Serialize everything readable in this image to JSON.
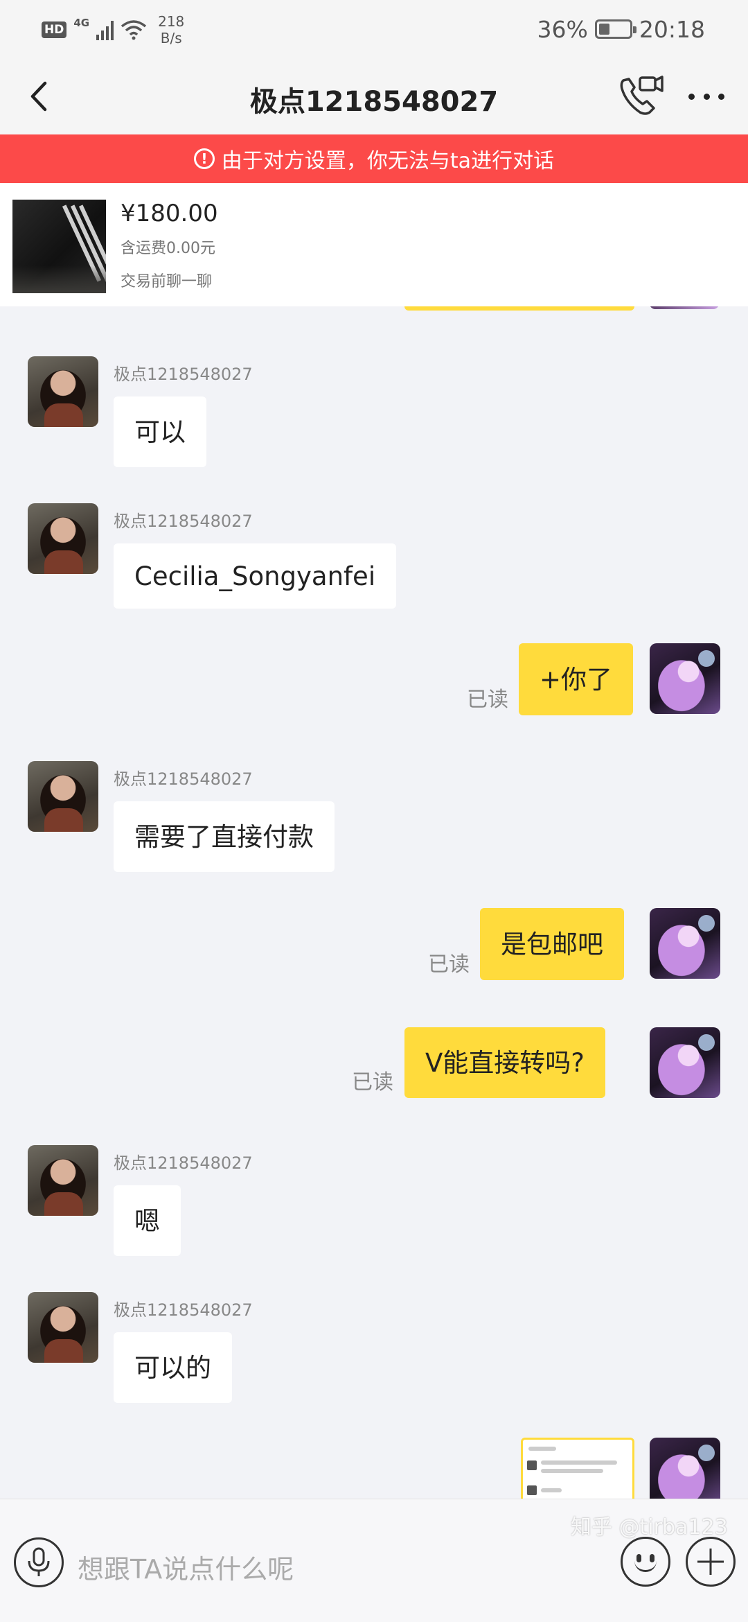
{
  "status_bar": {
    "hd": "HD",
    "network": "4G",
    "speed_value": "218",
    "speed_unit": "B/s",
    "battery": "36%",
    "battery_level": 0.36,
    "time": "20:18"
  },
  "nav": {
    "title": "极点1218548027"
  },
  "banner": {
    "icon": "!",
    "text": "由于对方设置，你无法与ta进行对话"
  },
  "product": {
    "price": "¥180.00",
    "shipping": "含运费0.00元",
    "hint": "交易前聊一聊"
  },
  "messages": [
    {
      "side": "in",
      "sender": "极点1218548027",
      "text": "可以"
    },
    {
      "side": "in",
      "sender": "极点1218548027",
      "text": "Cecilia_Songyanfei"
    },
    {
      "side": "out",
      "status": "已读",
      "text": "+你了"
    },
    {
      "side": "in",
      "sender": "极点1218548027",
      "text": "需要了直接付款"
    },
    {
      "side": "out",
      "status": "已读",
      "text": "是包邮吧"
    },
    {
      "side": "out",
      "status": "已读",
      "text": "V能直接转吗?"
    },
    {
      "side": "in",
      "sender": "极点1218548027",
      "text": "嗯"
    },
    {
      "side": "in",
      "sender": "极点1218548027",
      "text": "可以的"
    }
  ],
  "input": {
    "placeholder": "想跟TA说点什么呢"
  },
  "watermark": "知乎 @tirba123",
  "colors": {
    "banner_bg": "#fc4a49",
    "outgoing_bubble": "#ffdb3c",
    "incoming_bubble": "#ffffff",
    "chat_bg": "#f2f3f7"
  }
}
